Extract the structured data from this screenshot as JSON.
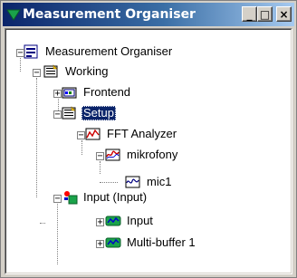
{
  "window": {
    "title": "Measurement Organiser",
    "minimize_glyph": "_",
    "maximize_glyph": "□",
    "close_glyph": "×"
  },
  "tree": {
    "nodes": [
      {
        "label": "Measurement Organiser",
        "icon": "organiser-tree-icon",
        "expander": "−"
      },
      {
        "label": "Working",
        "icon": "working-folder-icon",
        "expander": "−"
      },
      {
        "label": "Frontend",
        "icon": "frontend-icon",
        "expander": "+"
      },
      {
        "label": "Setup",
        "icon": "setup-folder-icon",
        "expander": "−",
        "selected": true
      },
      {
        "label": "FFT Analyzer",
        "icon": "fft-analyzer-icon",
        "expander": "−"
      },
      {
        "label": "mikrofony",
        "icon": "mikrofony-icon",
        "expander": "−"
      },
      {
        "label": "mic1",
        "icon": "signal-icon"
      },
      {
        "label": "Input (Input)",
        "icon": "input-device-icon",
        "expander": "−"
      },
      {
        "label": "Input",
        "icon": "input-channel-icon",
        "expander": "+"
      },
      {
        "label": "Multi-buffer 1",
        "icon": "multi-buffer-icon",
        "expander": "+"
      }
    ]
  }
}
